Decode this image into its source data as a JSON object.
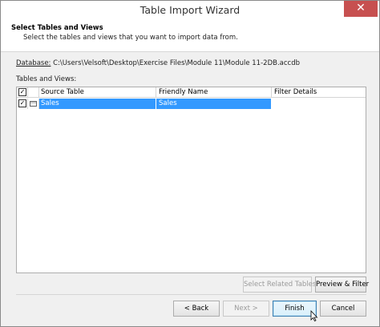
{
  "window": {
    "title": "Table Import Wizard",
    "close_glyph": "✕"
  },
  "header": {
    "title": "Select Tables and Views",
    "subtitle": "Select the tables and views that you want to import data from."
  },
  "database": {
    "label": "Database:",
    "path": "C:\\Users\\Velsoft\\Desktop\\Exercise Files\\Module 11\\Module 11-2DB.accdb"
  },
  "tables_label": "Tables and Views:",
  "grid": {
    "columns": [
      "Source Table",
      "Friendly Name",
      "Filter Details"
    ],
    "header_checked": true,
    "rows": [
      {
        "checked": true,
        "source_table": "Sales",
        "friendly_name": "Sales",
        "filter_details": ""
      }
    ]
  },
  "buttons": {
    "select_related": "Select Related Tables",
    "preview_filter": "Preview & Filter",
    "back": "< Back",
    "next": "Next >",
    "finish": "Finish",
    "cancel": "Cancel"
  },
  "icons": {
    "check_glyph": "✓",
    "table_icon": "table-icon",
    "cursor": "mouse-cursor-icon"
  },
  "colors": {
    "selection": "#3399ff",
    "close_button": "#c75050"
  }
}
